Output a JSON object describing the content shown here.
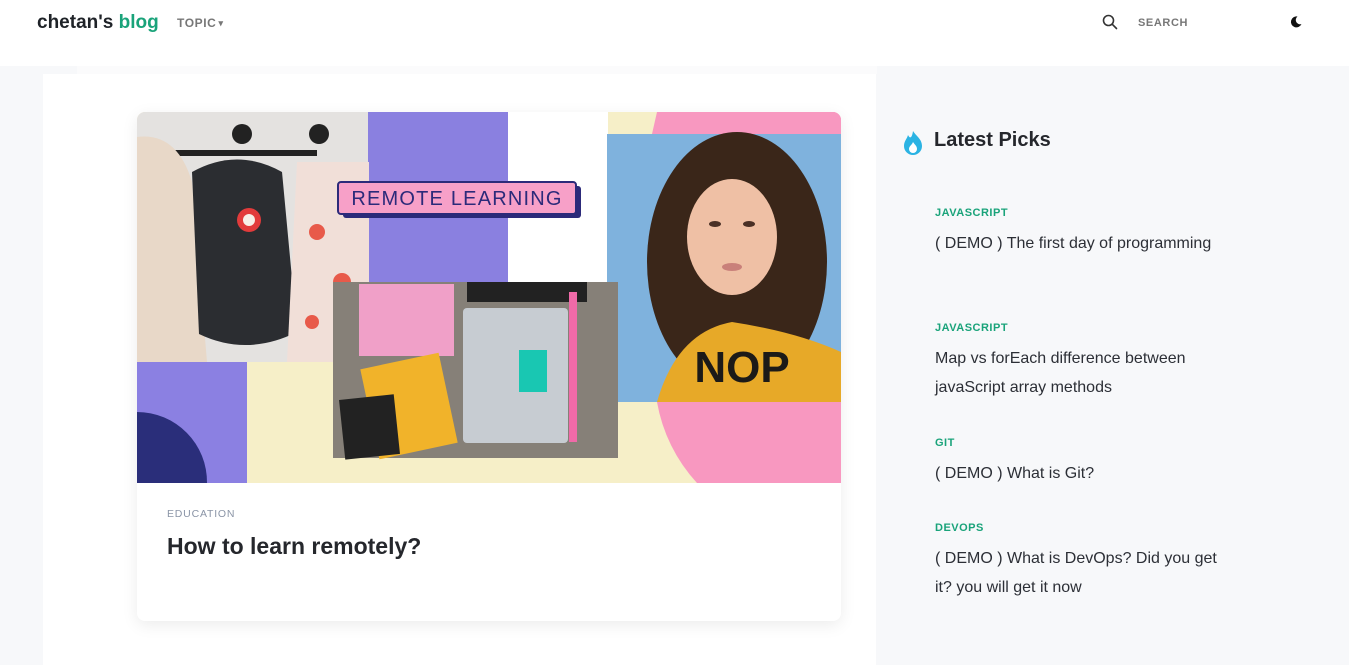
{
  "header": {
    "logo_main": "chetan's",
    "logo_accent": "blog",
    "topic_label": "TOPIC",
    "search_placeholder": "SEARCH",
    "accent_color": "#1aa37a"
  },
  "featured": {
    "category": "EDUCATION",
    "title": "How to learn remotely?",
    "image_label": "REMOTE LEARNING",
    "image_subject": "photo-collage-remote-learning"
  },
  "sidebar": {
    "title": "Latest Picks",
    "title_icon": "flame-icon",
    "picks": [
      {
        "category": "JAVASCRIPT",
        "title": "( DEMO ) The first day of programming"
      },
      {
        "category": "JAVASCRIPT",
        "title": "Map vs forEach difference between javaScript array methods"
      },
      {
        "category": "GIT",
        "title": "( DEMO ) What is Git?"
      },
      {
        "category": "DEVOPS",
        "title": "( DEMO ) What is DevOps? Did you get it? you will get it now"
      }
    ]
  },
  "icons": {
    "search": "search-icon",
    "theme": "moon-icon",
    "caret": "chevron-down-icon"
  }
}
